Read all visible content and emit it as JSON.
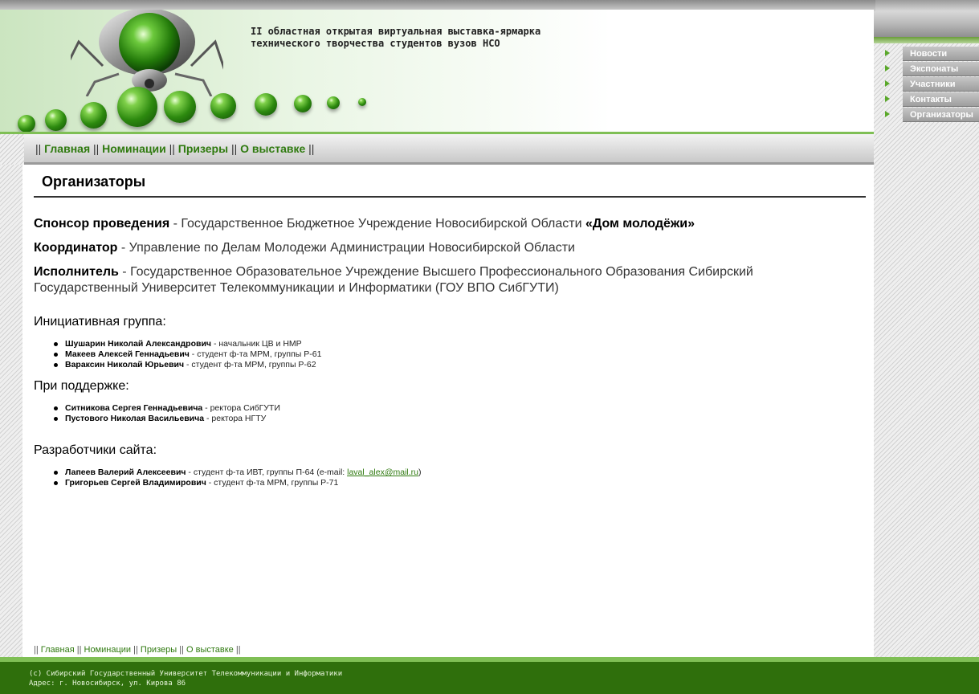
{
  "header": {
    "title_line1": "II областная открытая виртуальная выставка-ярмарка",
    "title_line2": "технического творчества студентов вузов НСО"
  },
  "top_nav": {
    "items": [
      "Главная",
      "Номинации",
      "Призеры",
      "О выставке"
    ],
    "separator": "||"
  },
  "side_menu": {
    "items": [
      "Новости",
      "Экспонаты",
      "Участники",
      "Контакты",
      "Организаторы"
    ]
  },
  "main": {
    "title": "Организаторы",
    "sponsor": {
      "label": "Спонсор проведения",
      "text": " - Государственное Бюджетное Учреждение Новосибирской Области ",
      "emphasis": "«Дом молодёжи»"
    },
    "coordinator": {
      "label": "Координатор",
      "text": " - Управление по Делам Молодежи Администрации Новосибирской Области"
    },
    "executor": {
      "label": "Исполнитель",
      "text": " - Государственное Образовательное Учреждение Высшего Профессионального Образования Сибирский Государственный Университет Телекоммуникации и Информатики (ГОУ ВПО СибГУТИ)"
    },
    "initiative": {
      "heading": "Инициативная группа:",
      "people": [
        {
          "name": "Шушарин Николай Александрович",
          "role": " - начальник ЦВ и НМР"
        },
        {
          "name": "Макеев Алексей Геннадьевич",
          "role": " - студент ф-та МРМ, группы Р-61"
        },
        {
          "name": "Вараксин Николай Юрьевич",
          "role": " - студент ф-та МРМ, группы Р-62"
        }
      ]
    },
    "support": {
      "heading": "При поддержке:",
      "people": [
        {
          "name": "Ситникова Сергея Геннадьевича",
          "role": " - ректора СибГУТИ"
        },
        {
          "name": "Пустового Николая Васильевича",
          "role": " - ректора НГТУ"
        }
      ]
    },
    "developers": {
      "heading": "Разработчики сайта:",
      "people": [
        {
          "name": "Лапеев Валерий Алексеевич",
          "role": " - студент ф-та ИВТ, группы П-64 (e-mail: ",
          "email": "laval_alex@mail.ru",
          "after": ")"
        },
        {
          "name": "Григорьев Сергей Владимирович",
          "role": " - студент ф-та МРМ, группы Р-71"
        }
      ]
    }
  },
  "bottom_nav": {
    "items": [
      "Главная",
      "Номинации",
      "Призеры",
      "О выставке"
    ]
  },
  "footer": {
    "line1": "(с) Сибирский Государственный Университет Телекоммуникации и Информатики",
    "line2": "Адрес: г. Новосибирск, ул. Кирова 86"
  },
  "colors": {
    "accent_green": "#2f7a0f",
    "footer_green": "#2f6f0c",
    "light_green": "#7fbf55"
  }
}
